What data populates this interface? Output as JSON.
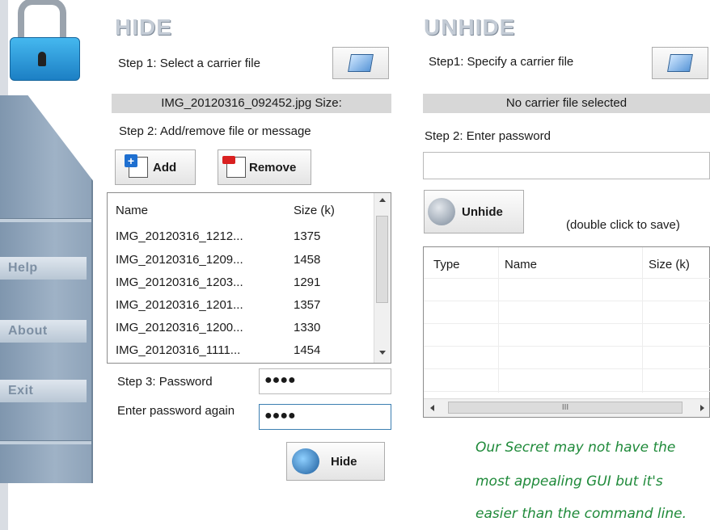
{
  "sidebar": {
    "buttons": [
      "Help",
      "About",
      "Exit"
    ]
  },
  "hide": {
    "heading": "HIDE",
    "step1_label": "Step 1: Select a carrier file",
    "carrier_file": "IMG_20120316_092452.jpg  Size:",
    "step2_label": "Step 2: Add/remove file or message",
    "add_label": "Add",
    "remove_label": "Remove",
    "list": {
      "columns": [
        "Name",
        "Size (k)"
      ],
      "rows": [
        [
          "IMG_20120316_1212...",
          "1375"
        ],
        [
          "IMG_20120316_1209...",
          "1458"
        ],
        [
          "IMG_20120316_1203...",
          "1291"
        ],
        [
          "IMG_20120316_1201...",
          "1357"
        ],
        [
          "IMG_20120316_1200...",
          "1330"
        ],
        [
          "IMG_20120316_1111...",
          "1454"
        ]
      ]
    },
    "step3_label": "Step 3: Password",
    "password_value": "●●●●",
    "password_again_label": "Enter password again",
    "password_again_value": "●●●●",
    "hide_button": "Hide"
  },
  "unhide": {
    "heading": "UNHIDE",
    "step1_label": "Step1: Specify a carrier file",
    "carrier_status": "No carrier file selected",
    "step2_label": "Step 2: Enter password",
    "password_value": "",
    "unhide_button": "Unhide",
    "hint": "(double click to save)",
    "table": {
      "columns": [
        "Type",
        "Name",
        "Size (k)"
      ],
      "scroll_glyph": "III"
    }
  },
  "caption": {
    "lines": [
      "Our Secret may not have the",
      "most appealing GUI but it's",
      "easier than the command line."
    ]
  },
  "colors": {
    "caption_green": "#1f8a3a",
    "sidebar_blue": "#8ea3b9",
    "lock_blue": "#1c7fc4"
  }
}
